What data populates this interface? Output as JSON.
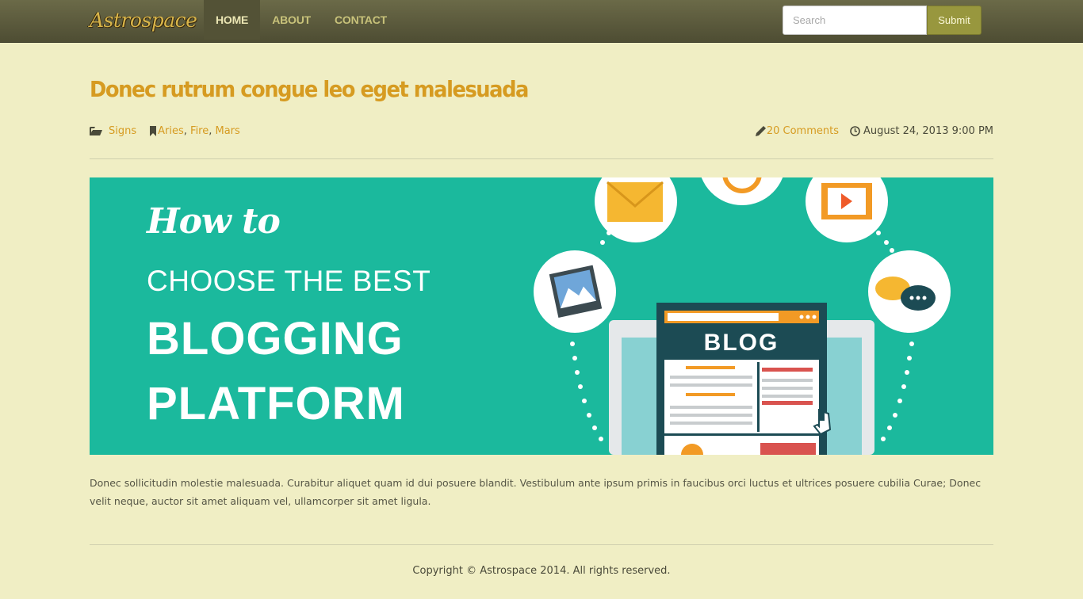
{
  "brand": {
    "name": "Astrospace"
  },
  "nav": {
    "items": [
      {
        "label": "HOME",
        "active": true
      },
      {
        "label": "ABOUT",
        "active": false
      },
      {
        "label": "CONTACT",
        "active": false
      }
    ]
  },
  "search": {
    "placeholder": "Search",
    "value": "",
    "submit_label": "Submit"
  },
  "post": {
    "title": "Donec rutrum congue leo eget malesuada",
    "category": "Signs",
    "tags": [
      "Aries",
      "Fire",
      "Mars"
    ],
    "comments": "20 Comments",
    "date": "August 24, 2013 9:00 PM",
    "image": {
      "line1": "How to",
      "line2": "CHOOSE THE BEST",
      "line3": "BLOGGING",
      "line4": "PLATFORM",
      "screen_label": "BLOG"
    },
    "body": "Donec sollicitudin molestie malesuada. Curabitur aliquet quam id dui posuere blandit. Vestibulum ante ipsum primis in faucibus orci luctus et ultrices posuere cubilia Curae; Donec velit neque, auctor sit amet aliquam vel, ullamcorper sit amet ligula."
  },
  "footer": {
    "copyright": "Copyright © Astrospace 2014. All rights reserved."
  },
  "colors": {
    "page_bg": "#f0eec4",
    "navbar": "#5c5b3d",
    "accent": "#d69b21",
    "submit": "#98973e",
    "hero_bg": "#1bb99d"
  }
}
